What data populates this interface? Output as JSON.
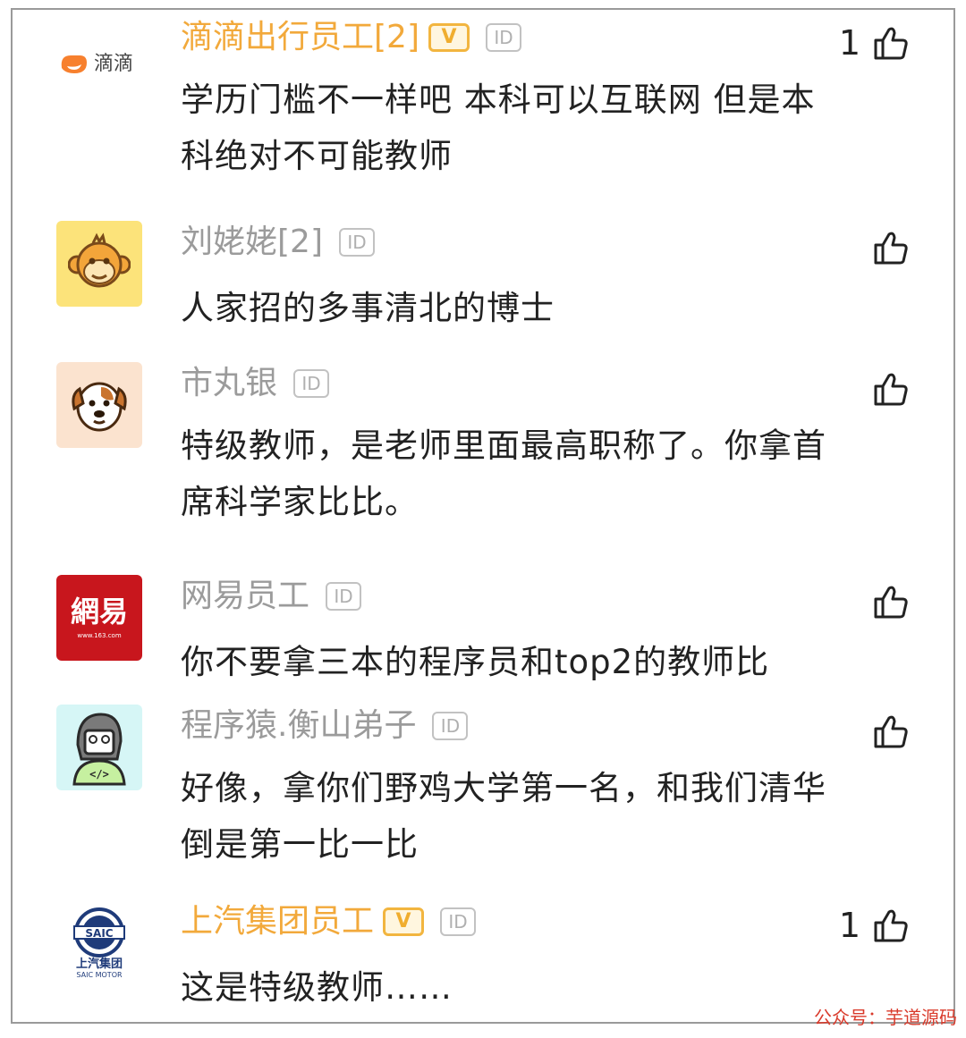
{
  "comments": [
    {
      "user": "滴滴出行员工[2]",
      "avatar_label": "滴滴",
      "verified": true,
      "verified_label": "V",
      "id_badge": "ID",
      "likes": "1",
      "text": "学历门槛不一样吧 本科可以互联网  但是本科绝对不可能教师"
    },
    {
      "user": "刘姥姥[2]",
      "avatar_label": "monkey-avatar",
      "verified": false,
      "id_badge": "ID",
      "likes": "",
      "text": "人家招的多事清北的博士"
    },
    {
      "user": "市丸银",
      "avatar_label": "dog-avatar",
      "verified": false,
      "id_badge": "ID",
      "likes": "",
      "text": "特级教师，是老师里面最高职称了。你拿首席科学家比比。"
    },
    {
      "user": "网易员工",
      "avatar_label": "網易",
      "avatar_sublabel": "www.163.com",
      "verified": false,
      "id_badge": "ID",
      "likes": "",
      "text": "你不要拿三本的程序员和top2的教师比"
    },
    {
      "user": "程序猿.衡山弟子",
      "avatar_label": "</>",
      "verified": false,
      "id_badge": "ID",
      "likes": "",
      "text": "好像，拿你们野鸡大学第一名，和我们清华倒是第一比一比"
    },
    {
      "user": "上汽集团员工",
      "avatar_label": "SAIC",
      "avatar_sublabel": "上汽集团",
      "avatar_sublabel2": "SAIC MOTOR",
      "verified": true,
      "verified_label": "V",
      "id_badge": "ID",
      "likes": "1",
      "text": "这是特级教师……"
    }
  ],
  "icons": {
    "like": "thumbs-up-icon"
  },
  "colors": {
    "gold": "#f2a93b",
    "gray": "#9b9b9b",
    "netease_red": "#c8161d",
    "watermark": "#d93a2b"
  },
  "watermark": "公众号：芋道源码"
}
